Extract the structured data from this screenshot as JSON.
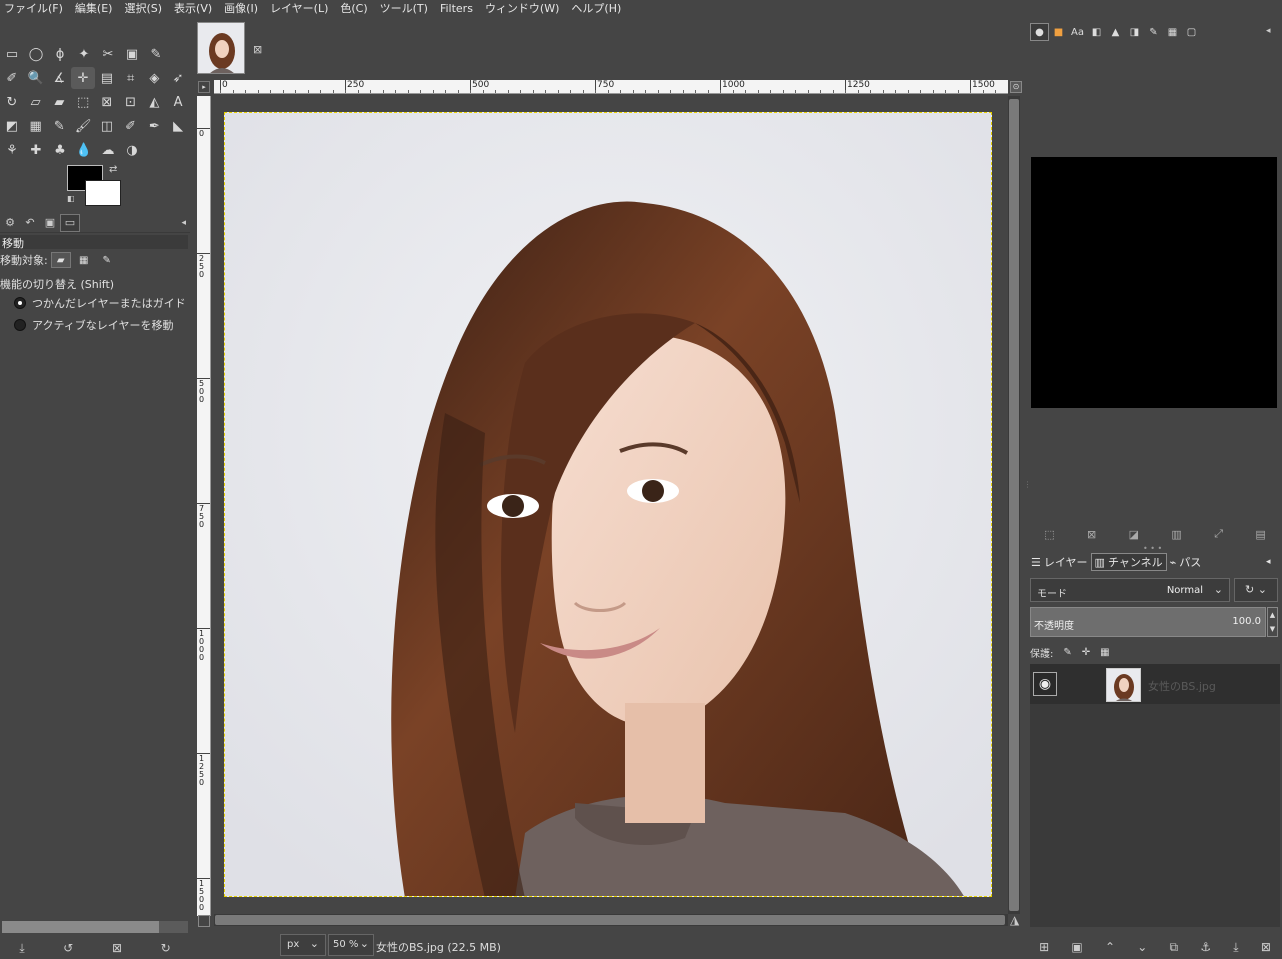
{
  "menu": [
    "ファイル(F)",
    "編集(E)",
    "選択(S)",
    "表示(V)",
    "画像(I)",
    "レイヤー(L)",
    "色(C)",
    "ツール(T)",
    "Filters",
    "ウィンドウ(W)",
    "ヘルプ(H)"
  ],
  "toolbox": {
    "rows": [
      [
        "rect-select-icon",
        "ellipse-select-icon",
        "free-select-icon",
        "fuzzy-select-icon",
        "scissors-icon",
        "foreground-select-icon",
        "paths-icon"
      ],
      [
        "color-picker-icon",
        "zoom-icon",
        "measure-icon",
        "move-icon",
        "align-icon",
        "crop-icon",
        "unified-transform-icon",
        "warp-transform-icon"
      ],
      [
        "rotate-icon",
        "shear-icon",
        "perspective-icon",
        "3d-transform-icon",
        "handle-transform-icon",
        "cage-transform-icon",
        "flip-icon",
        "text-icon"
      ],
      [
        "bucket-fill-icon",
        "gradient-icon",
        "pencil-icon",
        "paintbrush-icon",
        "eraser-icon",
        "airbrush-icon",
        "ink-icon",
        "mypaint-brush-icon"
      ],
      [
        "clone-icon",
        "heal-icon",
        "perspective-clone-icon",
        "blur-icon",
        "smudge-icon",
        "dodge-burn-icon"
      ]
    ],
    "glyphs": [
      [
        "▭",
        "◯",
        "ϕ",
        "✦",
        "✂",
        "▣",
        "✎"
      ],
      [
        "✐",
        "🔍",
        "∡",
        "✛",
        "▤",
        "⌗",
        "◈",
        "➶"
      ],
      [
        "↻",
        "▱",
        "▰",
        "⬚",
        "⊠",
        "⊡",
        "◭",
        "A"
      ],
      [
        "◩",
        "▦",
        "✎",
        "🖌",
        "◫",
        "✐",
        "✒",
        "◣"
      ],
      [
        "⚘",
        "✚",
        "♣",
        "💧",
        "☁",
        "◑"
      ]
    ]
  },
  "tool_options": {
    "title": "移動",
    "move_target_label": "移動対象:",
    "toggle_label": "機能の切り替え (Shift)",
    "option1": "つかんだレイヤーまたはガイド",
    "option2": "アクティブなレイヤーを移動"
  },
  "ruler_labels": [
    "0",
    "250",
    "500",
    "750",
    "1000",
    "1250",
    "1500"
  ],
  "vruler_labels": [
    "0",
    "250",
    "500",
    "750",
    "1000",
    "1250",
    "1500"
  ],
  "status": {
    "unit": "px",
    "zoom": "50 %",
    "filename": "女性のBS.jpg (22.5 MB)"
  },
  "layers_panel": {
    "tab_layers": "レイヤー",
    "tab_channels": "チャンネル",
    "tab_paths": "パス",
    "mode_label": "モード",
    "mode_value": "Normal",
    "opacity_label": "不透明度",
    "opacity_value": "100.0",
    "lock_label": "保護:",
    "layer_name": "女性のBS.jpg"
  },
  "colors": {
    "foreground": "#000000",
    "background": "#ffffff",
    "selection_border": "#e6d100"
  }
}
